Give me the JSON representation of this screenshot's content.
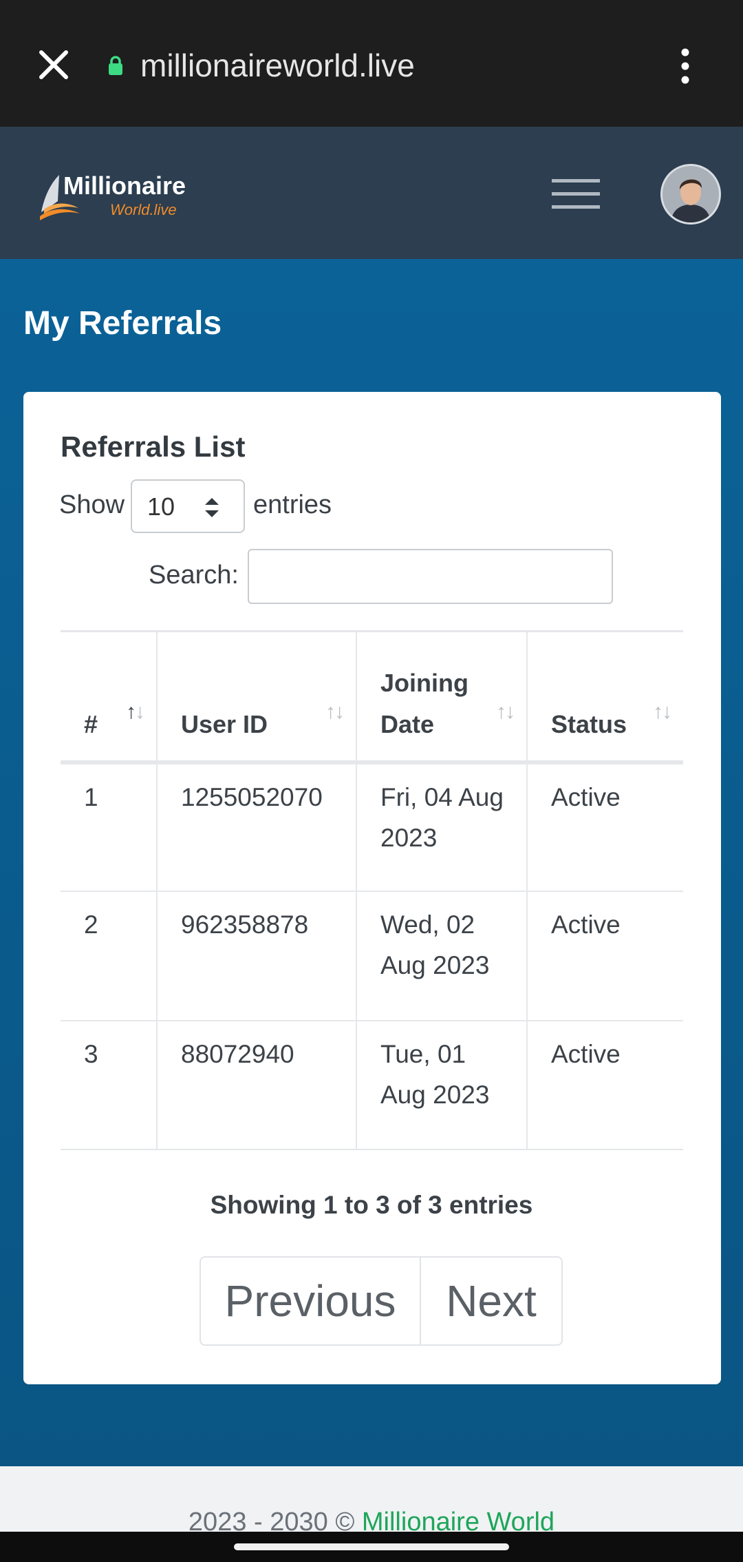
{
  "browser": {
    "url": "millionaireworld.live",
    "icons": {
      "close": "close-icon",
      "lock": "lock-icon",
      "menu": "more-vert-icon"
    }
  },
  "header": {
    "logo_line1": "Millionaire",
    "logo_line2": "World.live",
    "menu_icon": "hamburger-icon",
    "avatar": "user-avatar"
  },
  "page": {
    "title": "My Referrals"
  },
  "card": {
    "title": "Referrals List",
    "show_label": "Show",
    "entries_value": "10",
    "entries_label": "entries",
    "search_label": "Search:",
    "search_value": ""
  },
  "table": {
    "columns": [
      {
        "label": "#",
        "sort": "asc"
      },
      {
        "label": "User ID",
        "sort": "none"
      },
      {
        "label": "Joining Date",
        "sort": "none"
      },
      {
        "label": "Status",
        "sort": "none"
      }
    ],
    "rows": [
      {
        "num": "1",
        "user_id": "1255052070",
        "date": "Fri, 04 Aug 2023",
        "status": "Active"
      },
      {
        "num": "2",
        "user_id": "962358878",
        "date": "Wed, 02 Aug 2023",
        "status": "Active"
      },
      {
        "num": "3",
        "user_id": "88072940",
        "date": "Tue, 01 Aug 2023",
        "status": "Active"
      }
    ]
  },
  "pagination": {
    "info": "Showing 1 to 3 of 3 entries",
    "previous": "Previous",
    "next": "Next"
  },
  "footer": {
    "years": "2023 - 2030 ©",
    "brand": "Millionaire World"
  },
  "colors": {
    "browser_bar": "#1e1e1e",
    "header": "#2c3e50",
    "content": "#0a5f8e",
    "accent_orange": "#f28c28",
    "lock_green": "#3ddc84",
    "footer_link": "#1fa55a"
  }
}
